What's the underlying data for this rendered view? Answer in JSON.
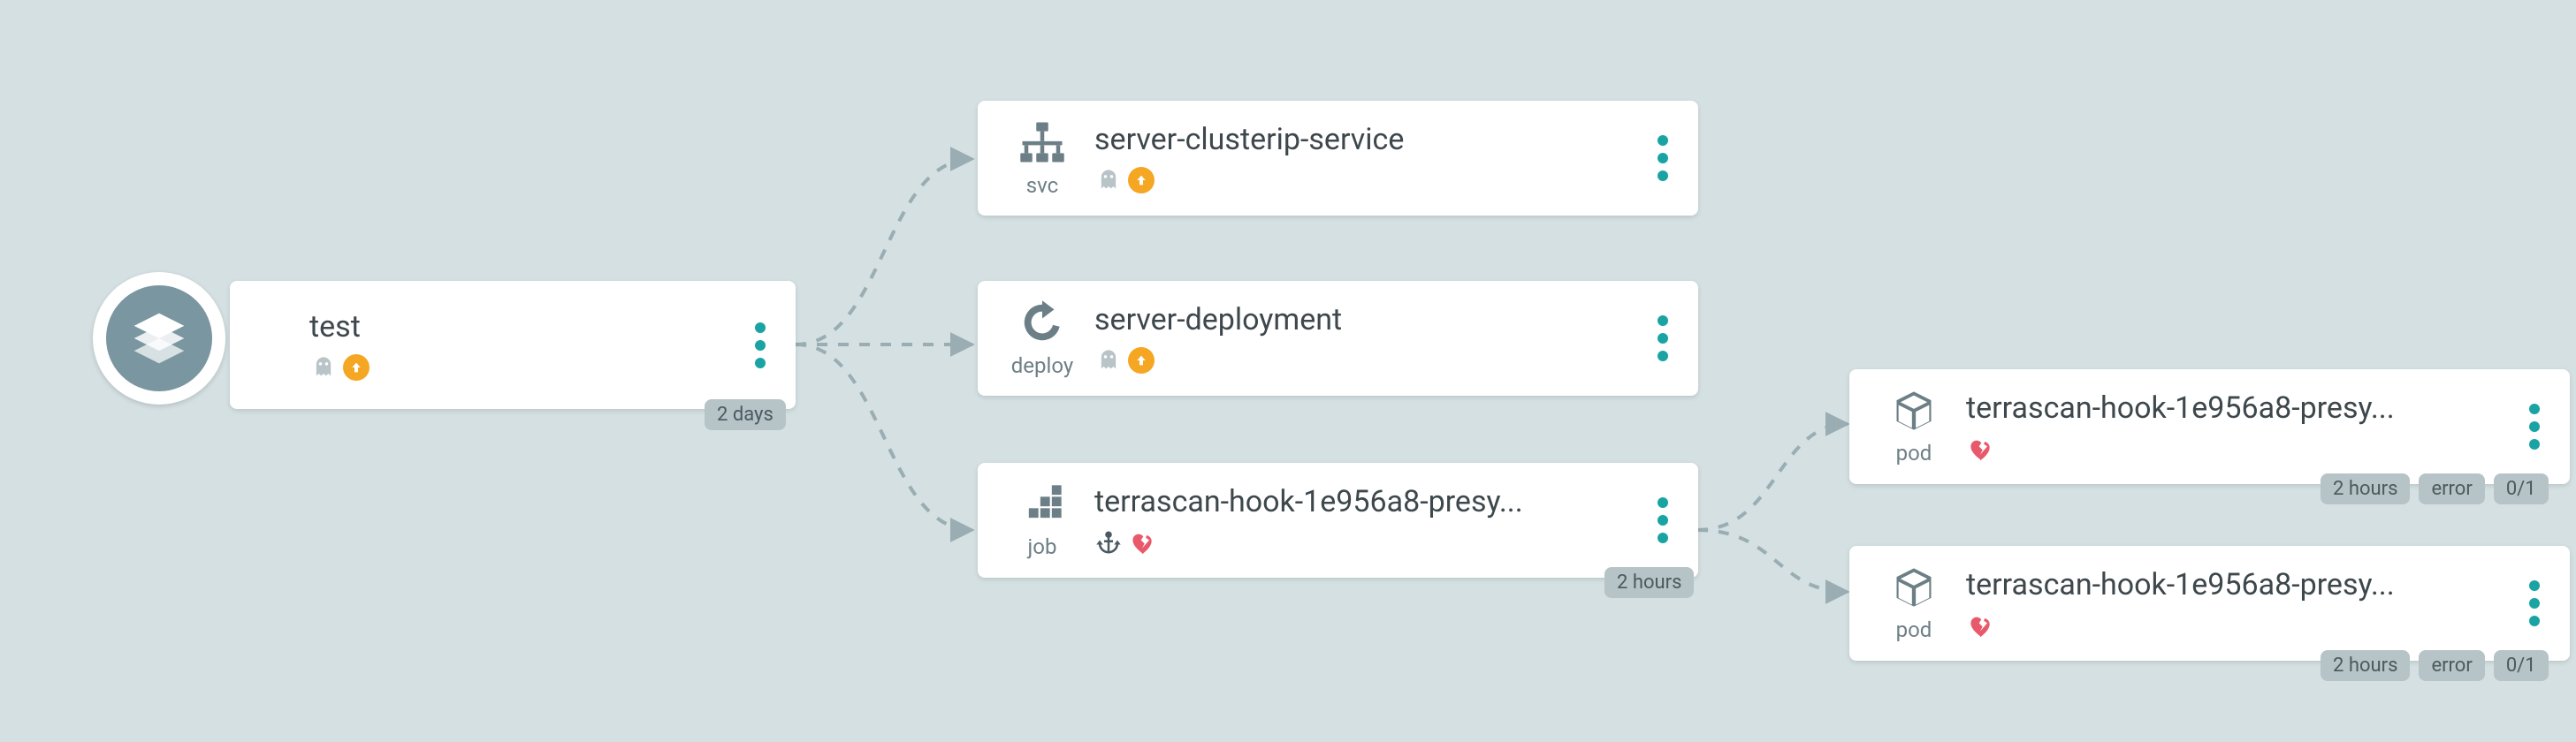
{
  "root": {
    "name": "test",
    "age_badge": "2 days",
    "status": [
      "ghost",
      "up"
    ]
  },
  "resources": [
    {
      "kind": "svc",
      "name": "server-clusterip-service",
      "status": [
        "ghost",
        "up"
      ]
    },
    {
      "kind": "deploy",
      "name": "server-deployment",
      "status": [
        "ghost",
        "up"
      ]
    },
    {
      "kind": "job",
      "name": "terrascan-hook-1e956a8-presy...",
      "status": [
        "anchor",
        "broken-heart"
      ],
      "age_badge": "2 hours"
    }
  ],
  "pods": [
    {
      "kind": "pod",
      "name": "terrascan-hook-1e956a8-presy...",
      "status": [
        "broken-heart"
      ],
      "chips": [
        "2 hours",
        "error",
        "0/1"
      ]
    },
    {
      "kind": "pod",
      "name": "terrascan-hook-1e956a8-presy...",
      "status": [
        "broken-heart"
      ],
      "chips": [
        "2 hours",
        "error",
        "0/1"
      ]
    }
  ],
  "colors": {
    "accent": "#1aa3a3",
    "bg": "#d4e0e2",
    "warn": "#f5a623",
    "error": "#e85a6b",
    "muted": "#6d7f86"
  }
}
